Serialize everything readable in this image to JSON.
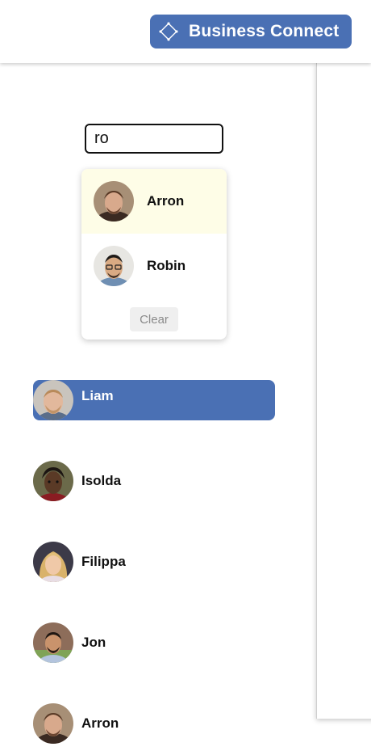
{
  "brand": {
    "name": "Business Connect",
    "color": "#4a70b4"
  },
  "search": {
    "value": "ro"
  },
  "suggestions": [
    {
      "name": "Arron",
      "highlighted": true
    },
    {
      "name": "Robin",
      "highlighted": false
    }
  ],
  "clear_label": "Clear",
  "users": [
    {
      "name": "Liam",
      "selected": true
    },
    {
      "name": "Isolda",
      "selected": false
    },
    {
      "name": "Filippa",
      "selected": false
    },
    {
      "name": "Jon",
      "selected": false
    },
    {
      "name": "Arron",
      "selected": false
    }
  ]
}
